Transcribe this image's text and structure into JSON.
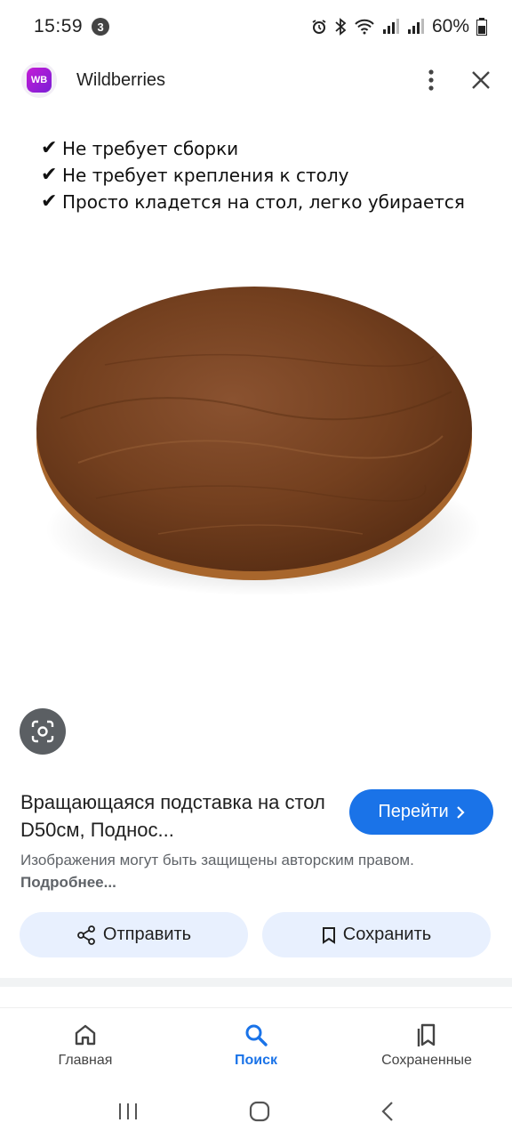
{
  "status": {
    "time": "15:59",
    "notification_count": "3",
    "battery": "60%"
  },
  "header": {
    "logo_text": "WB",
    "title": "Wildberries"
  },
  "image": {
    "features": [
      "Не требует сборки",
      "Не требует крепления к столу",
      "Просто кладется на стол, легко убирается"
    ]
  },
  "result": {
    "title": "Вращающаяся подставка на стол D50см, Поднос...",
    "go_label": "Перейти",
    "copyright_text": "Изображения могут быть защищены авторским правом.",
    "more_label": "Подробнее...",
    "share_label": "Отправить",
    "save_label": "Сохранить"
  },
  "bottom_nav": {
    "items": [
      {
        "label": "Главная",
        "icon": "home-icon"
      },
      {
        "label": "Поиск",
        "icon": "search-icon"
      },
      {
        "label": "Сохраненные",
        "icon": "saved-icon"
      }
    ]
  },
  "colors": {
    "accent": "#1a73e8",
    "action_bg": "#e8f0fe",
    "wood": "#7a4524"
  }
}
